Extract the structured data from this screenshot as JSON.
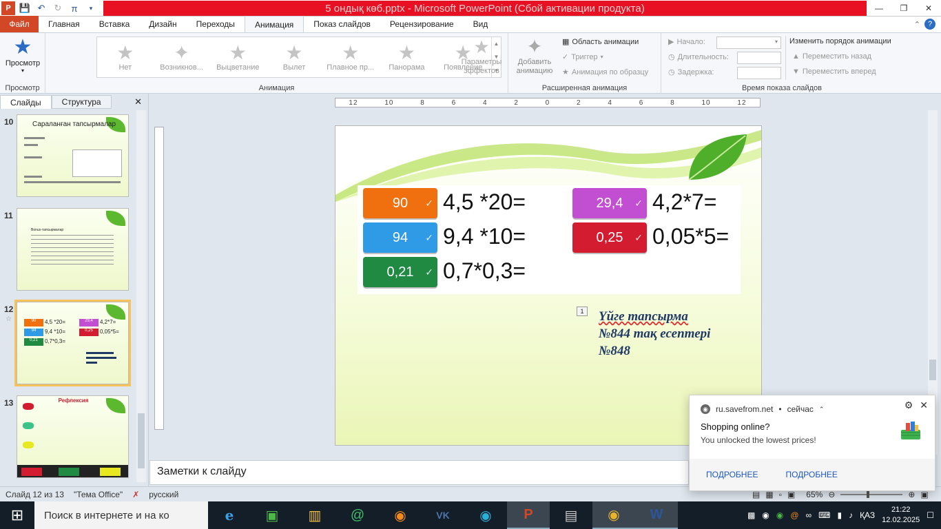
{
  "window": {
    "title": "5 ондық көб.pptx  -  Microsoft PowerPoint (Сбой активации продукта)"
  },
  "ribbon_tabs": [
    "Файл",
    "Главная",
    "Вставка",
    "Дизайн",
    "Переходы",
    "Анимация",
    "Показ слайдов",
    "Рецензирование",
    "Вид"
  ],
  "ribbon": {
    "preview_label": "Просмотр",
    "preview_group": "Просмотр",
    "animations": [
      "Нет",
      "Возникнов...",
      "Выцветание",
      "Вылет",
      "Плавное пр...",
      "Панорама",
      "Появление"
    ],
    "effect_params": "Параметры эффектов",
    "animation_group": "Анимация",
    "add_animation": "Добавить анимацию",
    "animation_pane": "Область анимации",
    "trigger": "Триггер",
    "animation_painter": "Анимация по образцу",
    "advanced_group": "Расширенная анимация",
    "start_label": "Начало:",
    "duration_label": "Длительность:",
    "delay_label": "Задержка:",
    "reorder_title": "Изменить порядок анимации",
    "move_back": "Переместить назад",
    "move_forward": "Переместить вперед",
    "timing_group": "Время показа слайдов"
  },
  "left_panel": {
    "tabs": [
      "Слайды",
      "Структура"
    ],
    "slides": [
      {
        "num": "10",
        "title": "Сараланған тапсырмалар"
      },
      {
        "num": "11",
        "title": "Bonus-тапсырмалар"
      },
      {
        "num": "12",
        "title": ""
      },
      {
        "num": "13",
        "title": "Рефлексия"
      }
    ]
  },
  "ruler": {
    "h_labels": [
      "12",
      "10",
      "8",
      "6",
      "4",
      "2",
      "0",
      "2",
      "4",
      "6",
      "8",
      "10",
      "12"
    ]
  },
  "slide": {
    "rows": [
      {
        "answer": "90",
        "expr": "4,5 *20=",
        "color": "#f0700f"
      },
      {
        "answer": "94",
        "expr": "9,4 *10=",
        "color": "#2f9be6"
      },
      {
        "answer": "0,21",
        "expr": "0,7*0,3=",
        "color": "#208a42"
      },
      {
        "answer": "29,4",
        "expr": "4,2*7=",
        "color": "#c24fd1"
      },
      {
        "answer": "0,25",
        "expr": "0,05*5=",
        "color": "#d41c30"
      }
    ],
    "anim_tag": "1",
    "homework": [
      "Үйге тапсырма",
      "№844 тақ есептері",
      "№848"
    ]
  },
  "notes_placeholder": "Заметки к слайду",
  "status": {
    "slide_counter": "Слайд 12 из 13",
    "theme": "\"Тема Office\"",
    "language": "русский",
    "zoom": "65%"
  },
  "taskbar": {
    "search_placeholder": "Поиск в интернете и на ко",
    "lang": "ҚАЗ",
    "time": "21:22",
    "date": "12.02.2025"
  },
  "toast": {
    "source": "ru.savefrom.net",
    "when": "сейчас",
    "title": "Shopping online?",
    "body": "You unlocked the lowest prices!",
    "action1": "ПОДРОБНЕЕ",
    "action2": "ПОДРОБНЕЕ"
  }
}
